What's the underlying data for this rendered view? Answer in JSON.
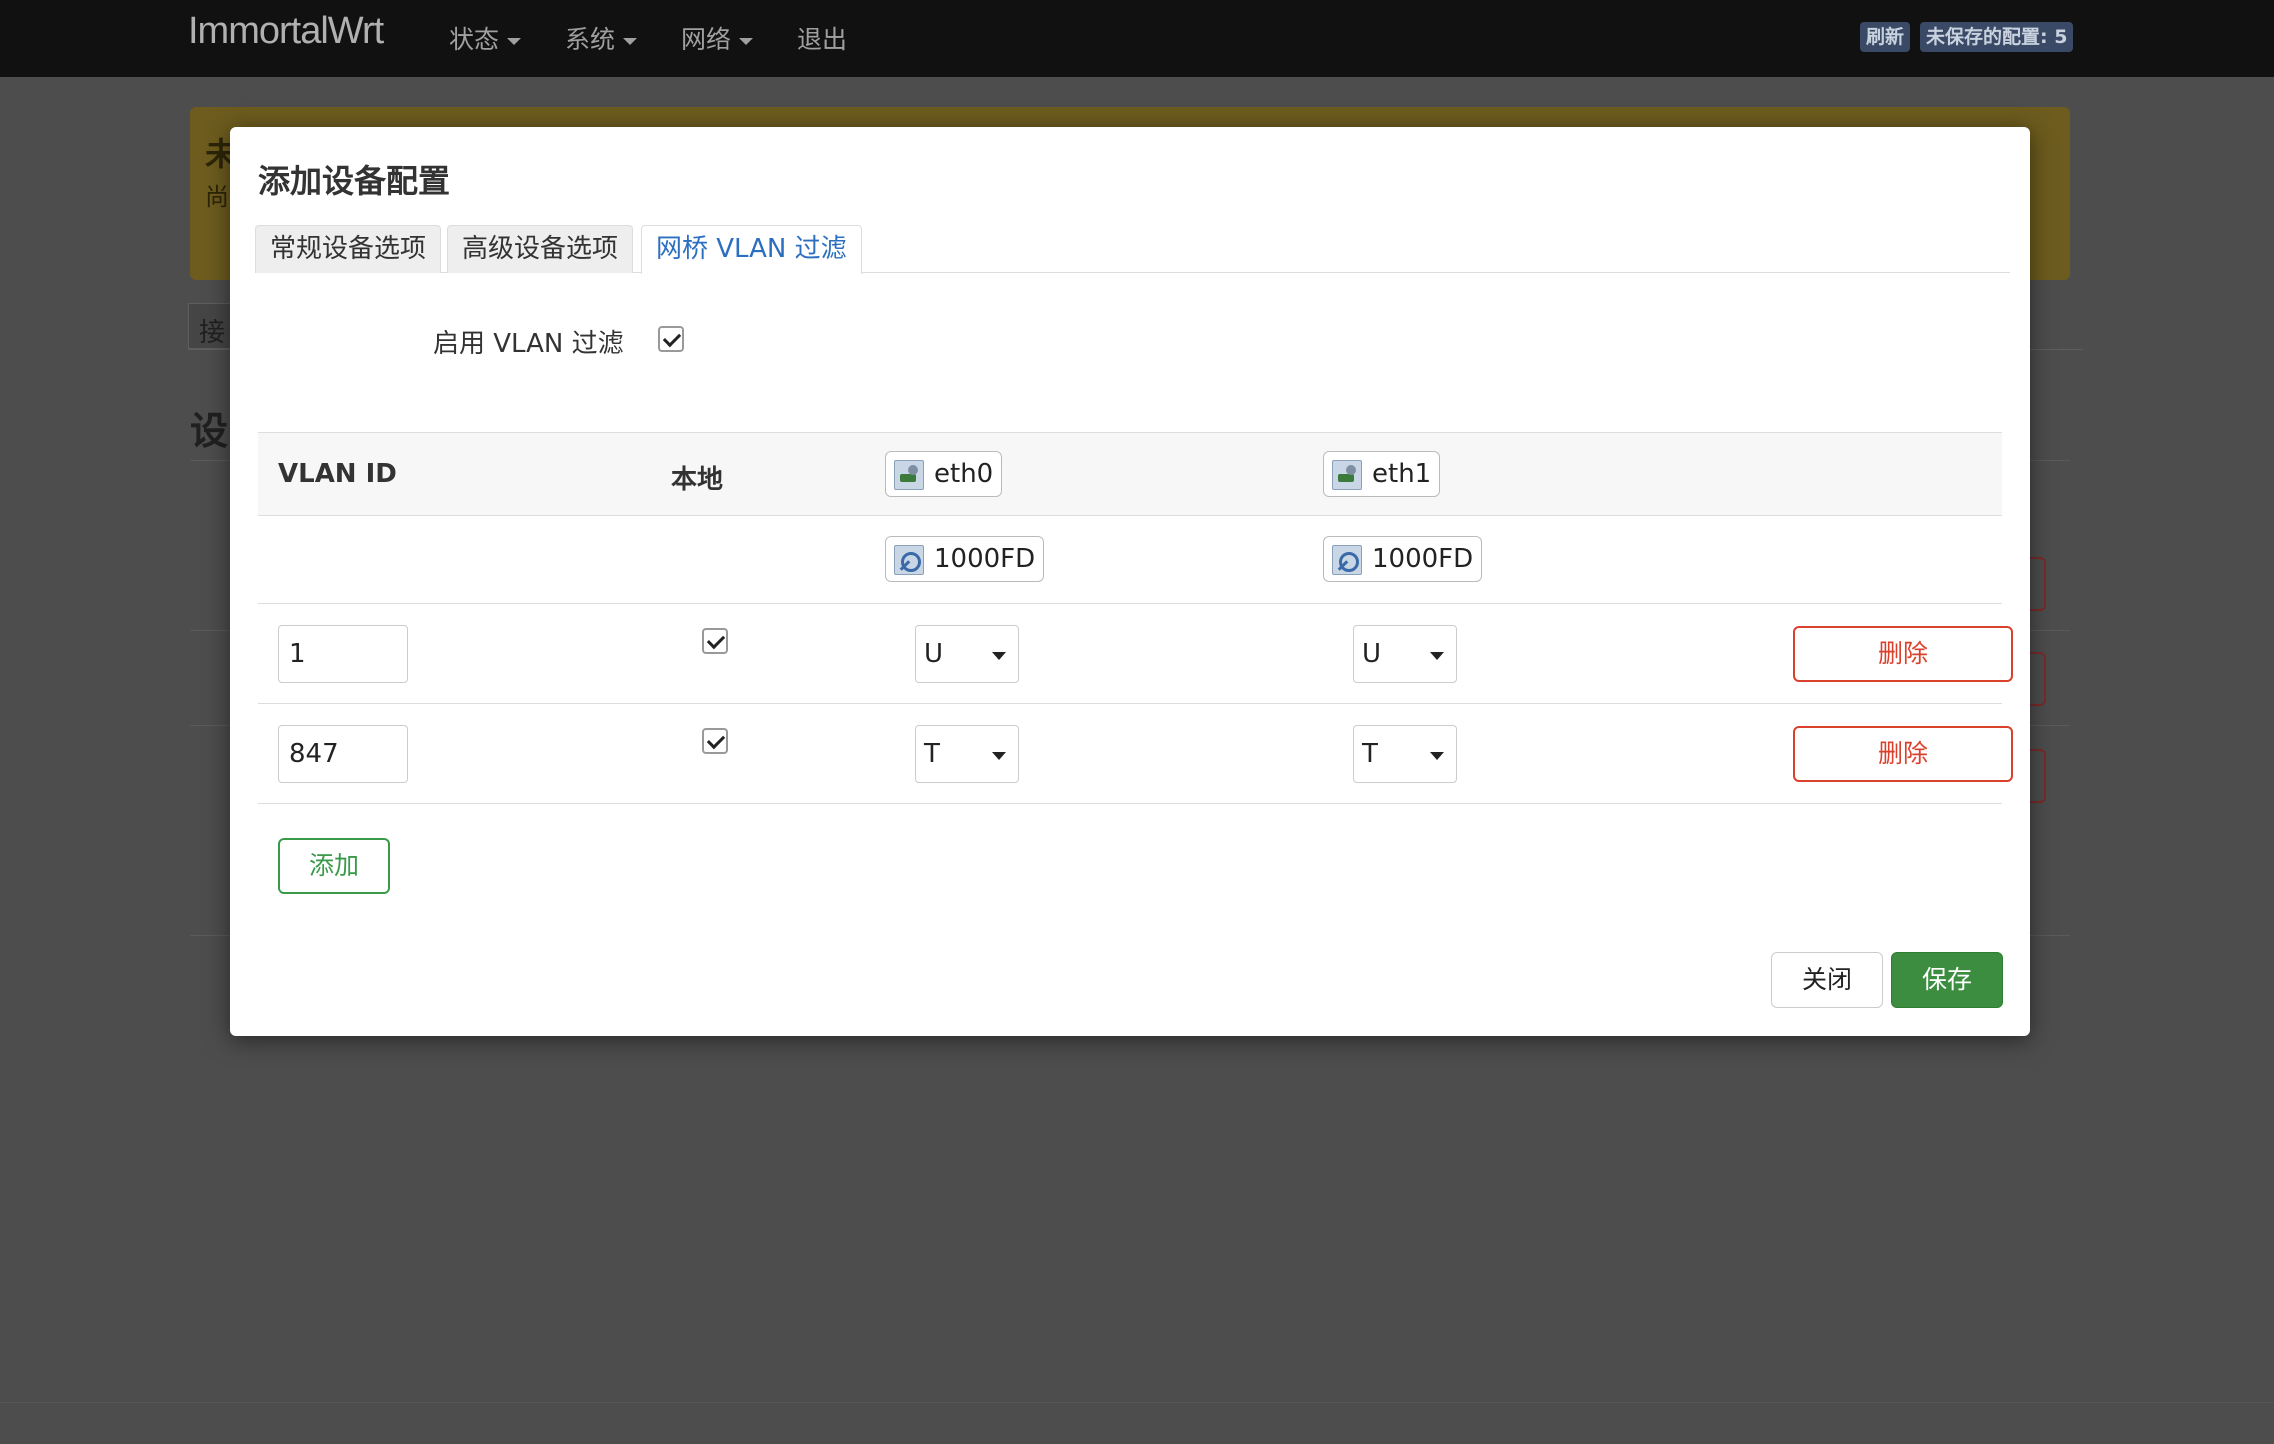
{
  "navbar": {
    "brand": "ImmortalWrt",
    "menu": [
      "状态",
      "系统",
      "网络",
      "退出"
    ],
    "refresh_badge": "刷新",
    "unsaved_badge": "未保存的配置: 5"
  },
  "background": {
    "warning_title": "未",
    "warning_text": "尚",
    "tab_fragment": "接",
    "heading_fragment": "设"
  },
  "modal": {
    "title": "添加设备配置",
    "tabs": [
      "常规设备选项",
      "高级设备选项",
      "网桥 VLAN 过滤"
    ],
    "active_tab": "网桥 VLAN 过滤",
    "enable_vlan_label": "启用 VLAN 过滤",
    "enable_vlan_checked": true,
    "table": {
      "headers": [
        "VLAN ID",
        "本地"
      ],
      "devices": [
        {
          "name": "eth0",
          "speed": "1000FD"
        },
        {
          "name": "eth1",
          "speed": "1000FD"
        }
      ],
      "rows": [
        {
          "vlan_id": "1",
          "local": true,
          "eth0": "U",
          "eth1": "U",
          "delete_label": "删除"
        },
        {
          "vlan_id": "847",
          "local": true,
          "eth0": "T",
          "eth1": "T",
          "delete_label": "删除"
        }
      ]
    },
    "add_label": "添加",
    "close_label": "关闭",
    "save_label": "保存"
  },
  "colors": {
    "accent_tab": "#2c6fc0",
    "delete": "#d9412c",
    "add": "#3a9a4a",
    "save": "#3c8d40"
  }
}
